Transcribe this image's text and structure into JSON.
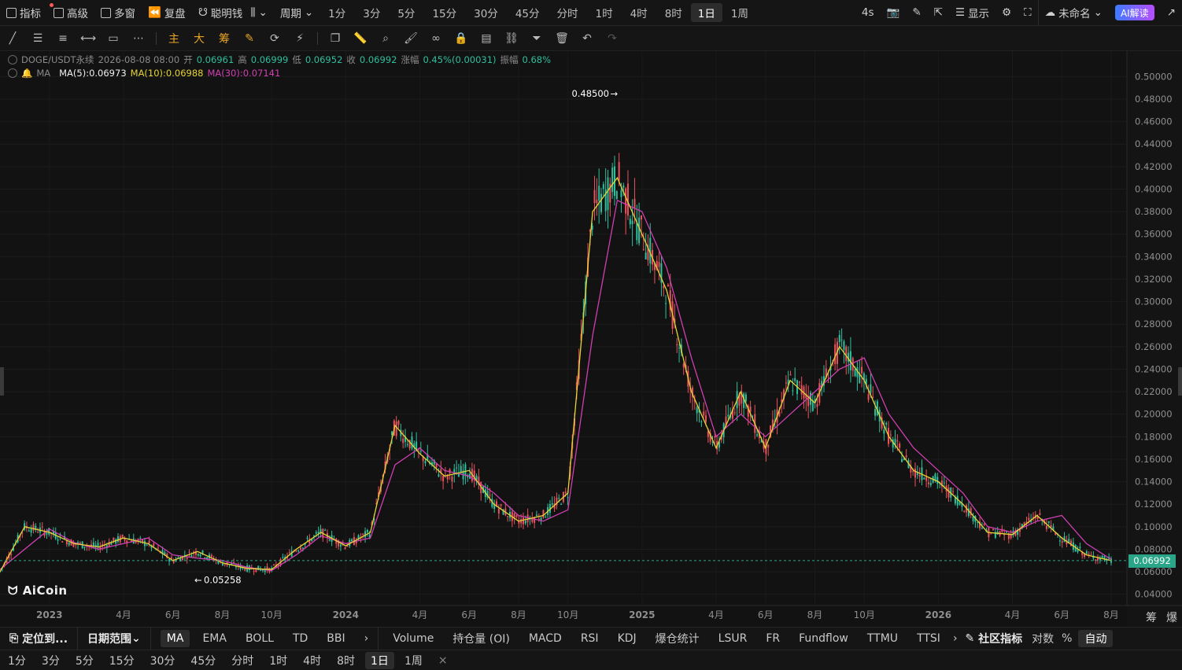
{
  "topbar": {
    "indicator": "指标",
    "advanced": "高级",
    "multi_window": "多窗",
    "replay": "复盘",
    "smart_money": "聪明钱",
    "period_label": "周期",
    "periods": [
      "1分",
      "3分",
      "5分",
      "15分",
      "30分",
      "45分",
      "分时",
      "1时",
      "4时",
      "8时",
      "1日",
      "1周"
    ],
    "active_period": "1日",
    "refresh": "4s",
    "display": "显示",
    "unnamed": "未命名",
    "ai": "AI解读"
  },
  "drawbar": {
    "labels": [
      "主",
      "大",
      "筹"
    ]
  },
  "legend": {
    "symbol": "DOGE/USDT永续",
    "datetime": "2026-08-08 08:00",
    "open_label": "开",
    "open": "0.06961",
    "high_label": "高",
    "high": "0.06999",
    "low_label": "低",
    "low": "0.06952",
    "close_label": "收",
    "close": "0.06992",
    "change_label": "涨幅",
    "change": "0.45%(0.00031)",
    "amp_label": "振幅",
    "amp": "0.68%",
    "ma_name": "MA",
    "ma5": "MA(5):0.06973",
    "ma10": "MA(10):0.06988",
    "ma30": "MA(30):0.07141"
  },
  "colors": {
    "up": "#2fbf9d",
    "down": "#e8545c",
    "ma5": "#f0f0f0",
    "ma10": "#e6d437",
    "ma30": "#d03fb2",
    "price": "#2aa587"
  },
  "chart_data": {
    "type": "line",
    "title": "DOGE/USDT永续",
    "y_ticks": [
      "0.50000",
      "0.48000",
      "0.46000",
      "0.44000",
      "0.42000",
      "0.40000",
      "0.38000",
      "0.36000",
      "0.34000",
      "0.32000",
      "0.30000",
      "0.28000",
      "0.26000",
      "0.24000",
      "0.22000",
      "0.20000",
      "0.18000",
      "0.16000",
      "0.14000",
      "0.12000",
      "0.10000",
      "0.08000",
      "0.06000",
      "0.04000"
    ],
    "ylim": [
      0.03,
      0.51
    ],
    "x_ticks": [
      "2023",
      "4月",
      "6月",
      "8月",
      "10月",
      "2024",
      "4月",
      "6月",
      "8月",
      "10月",
      "2025",
      "4月",
      "6月",
      "8月",
      "10月",
      "2026",
      "4月",
      "6月",
      "8月"
    ],
    "x": [
      "2022-11",
      "2022-12",
      "2023-01",
      "2023-02",
      "2023-03",
      "2023-04",
      "2023-05",
      "2023-06",
      "2023-07",
      "2023-08",
      "2023-09",
      "2023-10",
      "2023-11",
      "2023-12",
      "2024-01",
      "2024-02",
      "2024-03",
      "2024-04",
      "2024-05",
      "2024-06",
      "2024-07",
      "2024-08",
      "2024-09",
      "2024-10",
      "2024-11",
      "2024-12",
      "2025-01",
      "2025-02",
      "2025-03",
      "2025-04",
      "2025-05",
      "2025-06",
      "2025-07",
      "2025-08",
      "2025-09",
      "2025-10",
      "2025-11",
      "2025-12",
      "2026-01",
      "2026-02",
      "2026-03",
      "2026-04",
      "2026-05",
      "2026-06",
      "2026-07",
      "2026-08"
    ],
    "series": [
      {
        "name": "MA(30)",
        "values": [
          0.062,
          0.08,
          0.098,
          0.086,
          0.08,
          0.085,
          0.09,
          0.075,
          0.072,
          0.07,
          0.064,
          0.061,
          0.075,
          0.092,
          0.085,
          0.09,
          0.155,
          0.17,
          0.15,
          0.145,
          0.13,
          0.11,
          0.105,
          0.115,
          0.27,
          0.39,
          0.38,
          0.33,
          0.25,
          0.18,
          0.2,
          0.18,
          0.2,
          0.22,
          0.24,
          0.25,
          0.2,
          0.17,
          0.15,
          0.13,
          0.1,
          0.095,
          0.105,
          0.11,
          0.085,
          0.071
        ]
      },
      {
        "name": "MA(10)",
        "values": [
          0.06,
          0.1,
          0.095,
          0.085,
          0.082,
          0.09,
          0.085,
          0.07,
          0.078,
          0.068,
          0.063,
          0.062,
          0.08,
          0.095,
          0.083,
          0.095,
          0.19,
          0.165,
          0.145,
          0.15,
          0.12,
          0.105,
          0.11,
          0.13,
          0.38,
          0.41,
          0.36,
          0.31,
          0.22,
          0.17,
          0.22,
          0.17,
          0.23,
          0.21,
          0.26,
          0.23,
          0.18,
          0.15,
          0.14,
          0.12,
          0.095,
          0.093,
          0.11,
          0.09,
          0.075,
          0.0699
        ]
      }
    ],
    "annotations": [
      {
        "label": "0.48500"
      },
      {
        "label": "0.05258"
      }
    ],
    "last_price": "0.06992",
    "grid": true
  },
  "indbar": {
    "locate": "定位到...",
    "date_range": "日期范围",
    "main_inds": [
      "MA",
      "EMA",
      "BOLL",
      "TD",
      "BBI"
    ],
    "sub_inds": [
      "Volume",
      "持仓量 (OI)",
      "MACD",
      "RSI",
      "KDJ",
      "爆仓统计",
      "LSUR",
      "FR",
      "Fundflow",
      "TTMU",
      "TTSI"
    ],
    "community": "社区指标",
    "log": "对数",
    "percent": "%",
    "auto": "自动",
    "side_labels": [
      "筹",
      "爆"
    ]
  },
  "bottombar": {
    "periods": [
      "1分",
      "3分",
      "5分",
      "15分",
      "30分",
      "45分",
      "分时",
      "1时",
      "4时",
      "8时",
      "1日",
      "1周"
    ],
    "active": "1日",
    "close": "×"
  },
  "logo": "AiCoin"
}
